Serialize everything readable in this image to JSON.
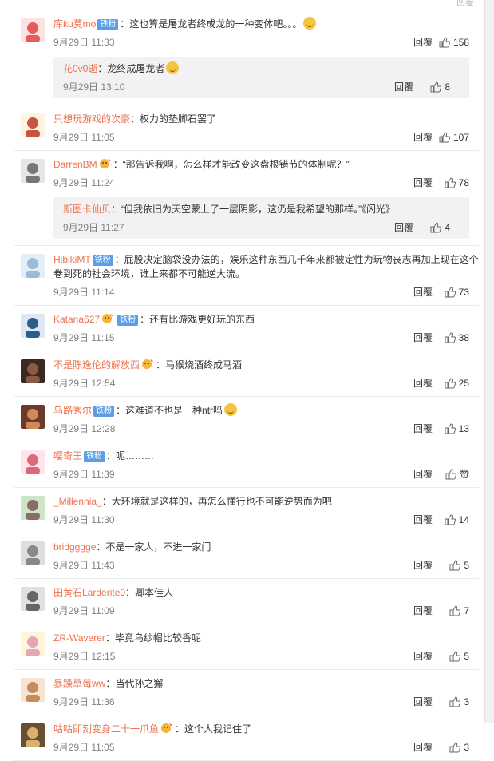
{
  "ghost_reply": "回覆",
  "comments": [
    {
      "user": "库ku莫mo",
      "badge": "铁粉",
      "text": "：这也算是屠龙者终成龙的一种变体吧。。。",
      "emoji": true,
      "time": "9月29日 11:33",
      "reply": "回覆",
      "likes": "158",
      "sub": {
        "user": "花0v0逝",
        "text": "：龙终成屠龙者",
        "emoji": true,
        "time": "9月29日 13:10",
        "reply": "回覆",
        "likes": "8"
      }
    },
    {
      "user": "只想玩游戏的次豪",
      "text": "：权力的垫脚石罢了",
      "time": "9月29日 11:05",
      "reply": "回覆",
      "likes": "107"
    },
    {
      "user": "DarrenBM",
      "fan": true,
      "text": "：“那告诉我啊，怎么样才能改变这盘根错节的体制呢？”",
      "time": "9月29日 11:24",
      "reply": "回覆",
      "likes": "78",
      "sub": {
        "user": "斯图卡仙贝",
        "text": "：“但我依旧为天空蒙上了一层阴影，这仍是我希望的那样。”《闪光》",
        "time": "9月29日 11:27",
        "reply": "回覆",
        "likes": "4"
      }
    },
    {
      "user": "HibikiMT",
      "badge": "铁粉",
      "text": "：屁股决定脑袋没办法的，娱乐这种东西几千年来都被定性为玩物丧志再加上现在这个卷到死的社会环境，谁上来都不可能逆大流。",
      "time": "9月29日 11:14",
      "reply": "回覆",
      "likes": "73"
    },
    {
      "user": "Katana627",
      "fan": true,
      "badge": "铁粉",
      "text": "：还有比游戏更好玩的东西",
      "time": "9月29日 11:15",
      "reply": "回覆",
      "likes": "38"
    },
    {
      "user": "不是陈逸伦的解放西",
      "fan": true,
      "text": "：马猴烧酒终成马酒",
      "time": "9月29日 12:54",
      "reply": "回覆",
      "likes": "25"
    },
    {
      "user": "乌路秀尔",
      "badge": "铁粉",
      "text": "：这难道不也是一种ntr吗",
      "emoji": true,
      "time": "9月29日 12:28",
      "reply": "回覆",
      "likes": "13"
    },
    {
      "user": "嘤奇王",
      "badge": "铁粉",
      "text": "：呃………",
      "time": "9月29日 11:39",
      "reply": "回覆",
      "likes": "赞"
    },
    {
      "user": "_Millennia_",
      "text": "：大环境就是这样的，再怎么懂行也不可能逆势而为吧",
      "time": "9月29日 11:30",
      "reply": "回覆",
      "likes": "14"
    },
    {
      "user": "bridgggge",
      "text": "：不是一家人，不进一家门",
      "time": "9月29日 11:43",
      "reply": "回覆",
      "likes": "5"
    },
    {
      "user": "田黄石Larderite0",
      "text": "：卿本佳人",
      "time": "9月29日 11:09",
      "reply": "回覆",
      "likes": "7"
    },
    {
      "user": "ZR-Waverer",
      "text": "：毕竟乌纱帽比较香呢",
      "time": "9月29日 12:15",
      "reply": "回覆",
      "likes": "5"
    },
    {
      "user": "暴躁草莓ww",
      "text": "：当代孙之獬",
      "time": "9月29日 11:36",
      "reply": "回覆",
      "likes": "3"
    },
    {
      "user": "咕咕即刻变身二十一爪鱼",
      "fan": true,
      "text": "：这个人我记住了",
      "time": "9月29日 11:05",
      "reply": "回覆",
      "likes": "3"
    }
  ],
  "colors": {
    "username": "#eb7350",
    "badge": "#5a9ee8",
    "subreply_bg": "#f2f2f5"
  }
}
